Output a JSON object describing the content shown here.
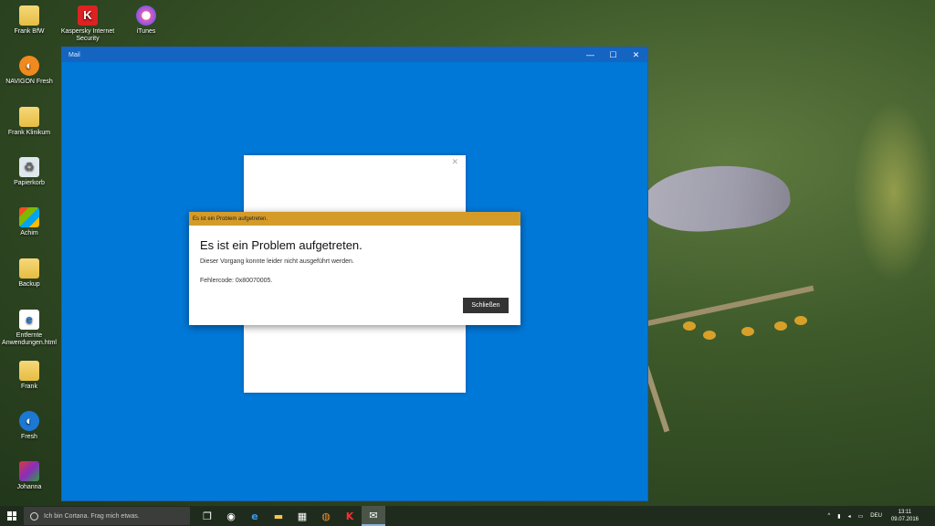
{
  "desktop": {
    "icons": [
      {
        "label": "Frank BfW",
        "glyph": "📁"
      },
      {
        "label": "Kaspersky Internet Security",
        "glyph": "K"
      },
      {
        "label": "iTunes",
        "glyph": "♪"
      },
      {
        "label": "NAVIGON Fresh",
        "glyph": "◐"
      },
      {
        "label": "Frank Klinikum",
        "glyph": "📁"
      },
      {
        "label": "Papierkorb",
        "glyph": "♻"
      },
      {
        "label": "Achim",
        "glyph": ""
      },
      {
        "label": "Backup",
        "glyph": "📁"
      },
      {
        "label": "Entfernte Anwendungen.html",
        "glyph": "e"
      },
      {
        "label": "Frank",
        "glyph": "📁"
      },
      {
        "label": "Fresh",
        "glyph": "◐"
      },
      {
        "label": "Johanna",
        "glyph": "◆"
      }
    ]
  },
  "window": {
    "title": "Mail",
    "minimize": "—",
    "maximize": "☐",
    "close": "✕",
    "panel_close": "✕"
  },
  "dialog": {
    "title": "Es ist ein Problem aufgetreten.",
    "heading": "Es ist ein Problem aufgetreten.",
    "message": "Dieser Vorgang konnte leider nicht ausgeführt werden.",
    "error_code": "Fehlercode: 0x80070005.",
    "close_button": "Schließen",
    "accent_color": "#d49b29"
  },
  "taskbar": {
    "search_placeholder": "Ich bin Cortana. Frag mich etwas.",
    "apps": [
      {
        "name": "task-view",
        "glyph": "❐"
      },
      {
        "name": "chrome",
        "glyph": "◉"
      },
      {
        "name": "edge",
        "glyph": "e"
      },
      {
        "name": "explorer",
        "glyph": "▬"
      },
      {
        "name": "store",
        "glyph": "▦"
      },
      {
        "name": "firefox",
        "glyph": "◍"
      },
      {
        "name": "kaspersky",
        "glyph": "K"
      },
      {
        "name": "mail",
        "glyph": "✉"
      }
    ],
    "tray": {
      "chevron": "^",
      "network": "▮",
      "volume": "◂",
      "keyboard": "▭",
      "language": "DEU",
      "time": "13:11",
      "date": "09.07.2016"
    }
  }
}
